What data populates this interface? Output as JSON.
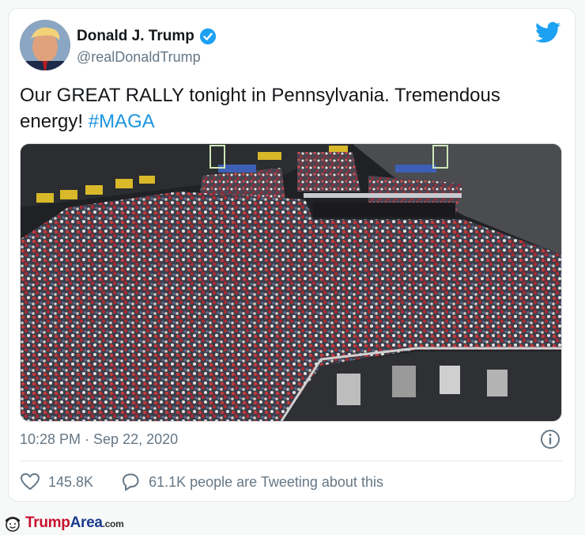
{
  "tweet": {
    "author_name": "Donald J. Trump",
    "author_handle": "@realDonaldTrump",
    "text_main": "Our GREAT RALLY tonight in Pennsylvania. Tremendous energy! ",
    "hashtag": "#MAGA",
    "timestamp": "10:28 PM · Sep 22, 2020",
    "likes": "145.8K",
    "tweeting": "61.1K people are Tweeting about this"
  },
  "watermark": {
    "brand_trump": "Trump",
    "brand_area": "Area",
    "brand_com": ".com"
  },
  "colors": {
    "link_blue": "#1b95e0",
    "verified_blue": "#1da1f2",
    "text_dark": "#14171a",
    "text_gray": "#657786"
  },
  "icons": [
    "verified-badge-icon",
    "twitter-bird-icon",
    "info-icon",
    "heart-icon",
    "comment-icon",
    "smiley-hat-icon"
  ]
}
